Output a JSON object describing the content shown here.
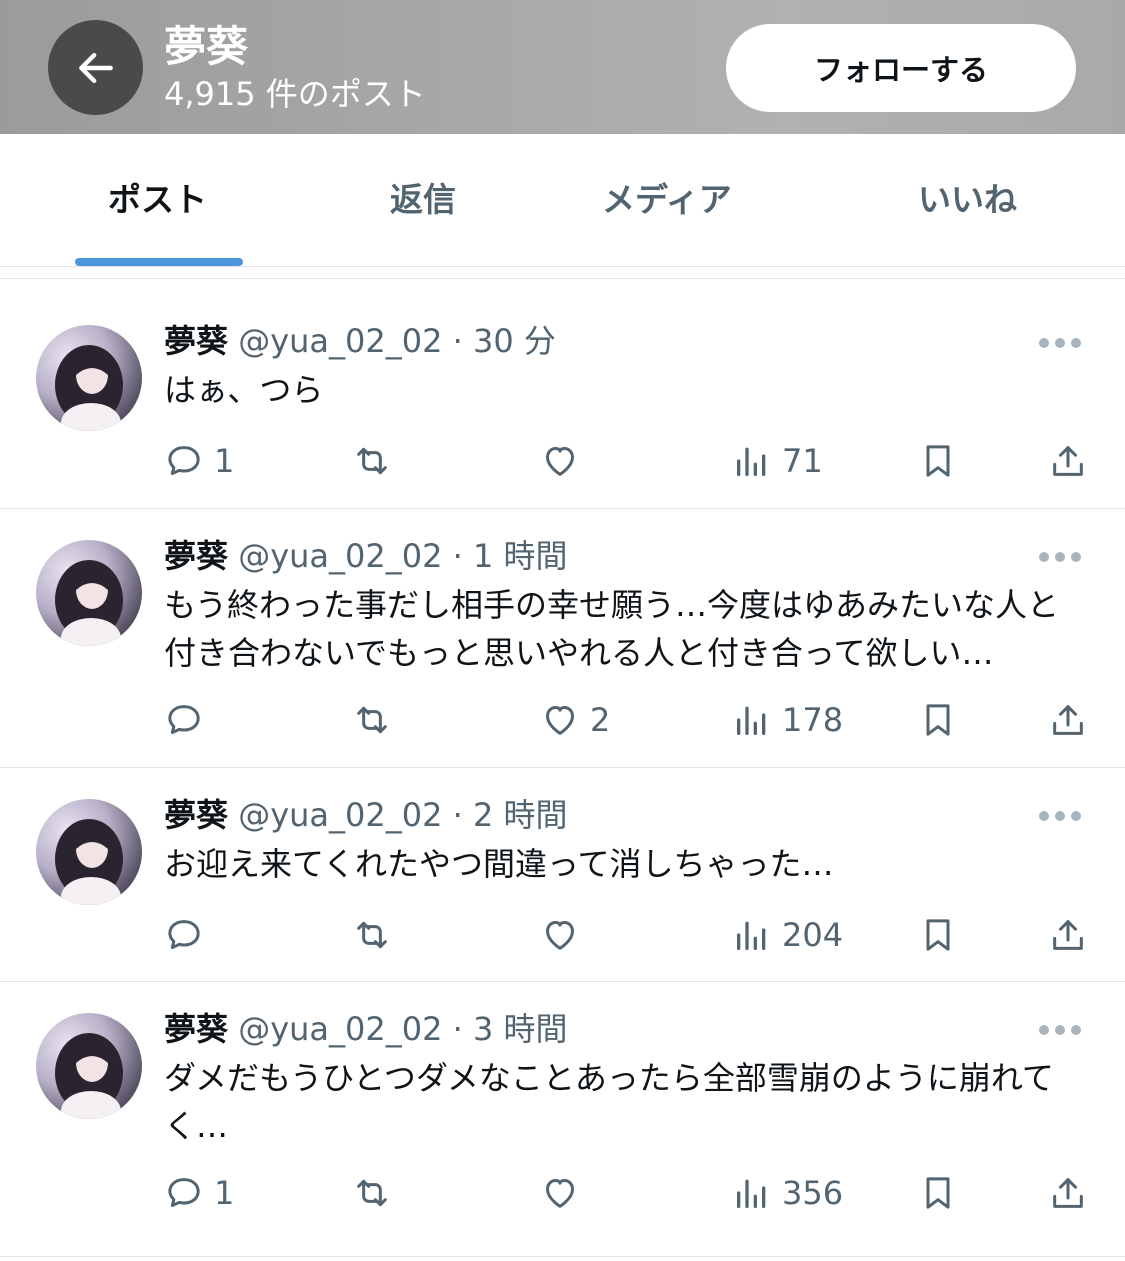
{
  "header": {
    "name": "夢葵",
    "post_count": "4,915 件のポスト",
    "follow_label": "フォローする"
  },
  "tabs": [
    {
      "label": "ポスト",
      "active": true
    },
    {
      "label": "返信",
      "active": false
    },
    {
      "label": "メディア",
      "active": false
    },
    {
      "label": "いいね",
      "active": false
    }
  ],
  "posts": [
    {
      "name": "夢葵",
      "handle": "@yua_02_02",
      "time": "· 30 分",
      "text": "はぁ、つら",
      "replies": "1",
      "likes": "",
      "views": "71"
    },
    {
      "name": "夢葵",
      "handle": "@yua_02_02",
      "time": "· 1 時間",
      "text": "もう終わった事だし相手の幸せ願う…今度はゆあみたいな人と付き合わないでもっと思いやれる人と付き合って欲しい…",
      "replies": "",
      "likes": "2",
      "views": "178"
    },
    {
      "name": "夢葵",
      "handle": "@yua_02_02",
      "time": "· 2 時間",
      "text": "お迎え来てくれたやつ間違って消しちゃった…",
      "replies": "",
      "likes": "",
      "views": "204"
    },
    {
      "name": "夢葵",
      "handle": "@yua_02_02",
      "time": "· 3 時間",
      "text": "ダメだもうひとつダメなことあったら全部雪崩のように崩れてく…",
      "replies": "1",
      "likes": "",
      "views": "356"
    }
  ],
  "icons": {
    "back": "arrow-left-icon",
    "more": "more-dots-icon",
    "reply": "reply-bubble-icon",
    "repost": "repost-icon",
    "like": "heart-icon",
    "views": "views-bar-icon",
    "bookmark": "bookmark-icon",
    "share": "share-upload-icon"
  },
  "colors": {
    "accent": "#4d95db",
    "text": "#0f1419",
    "muted": "#536471"
  }
}
